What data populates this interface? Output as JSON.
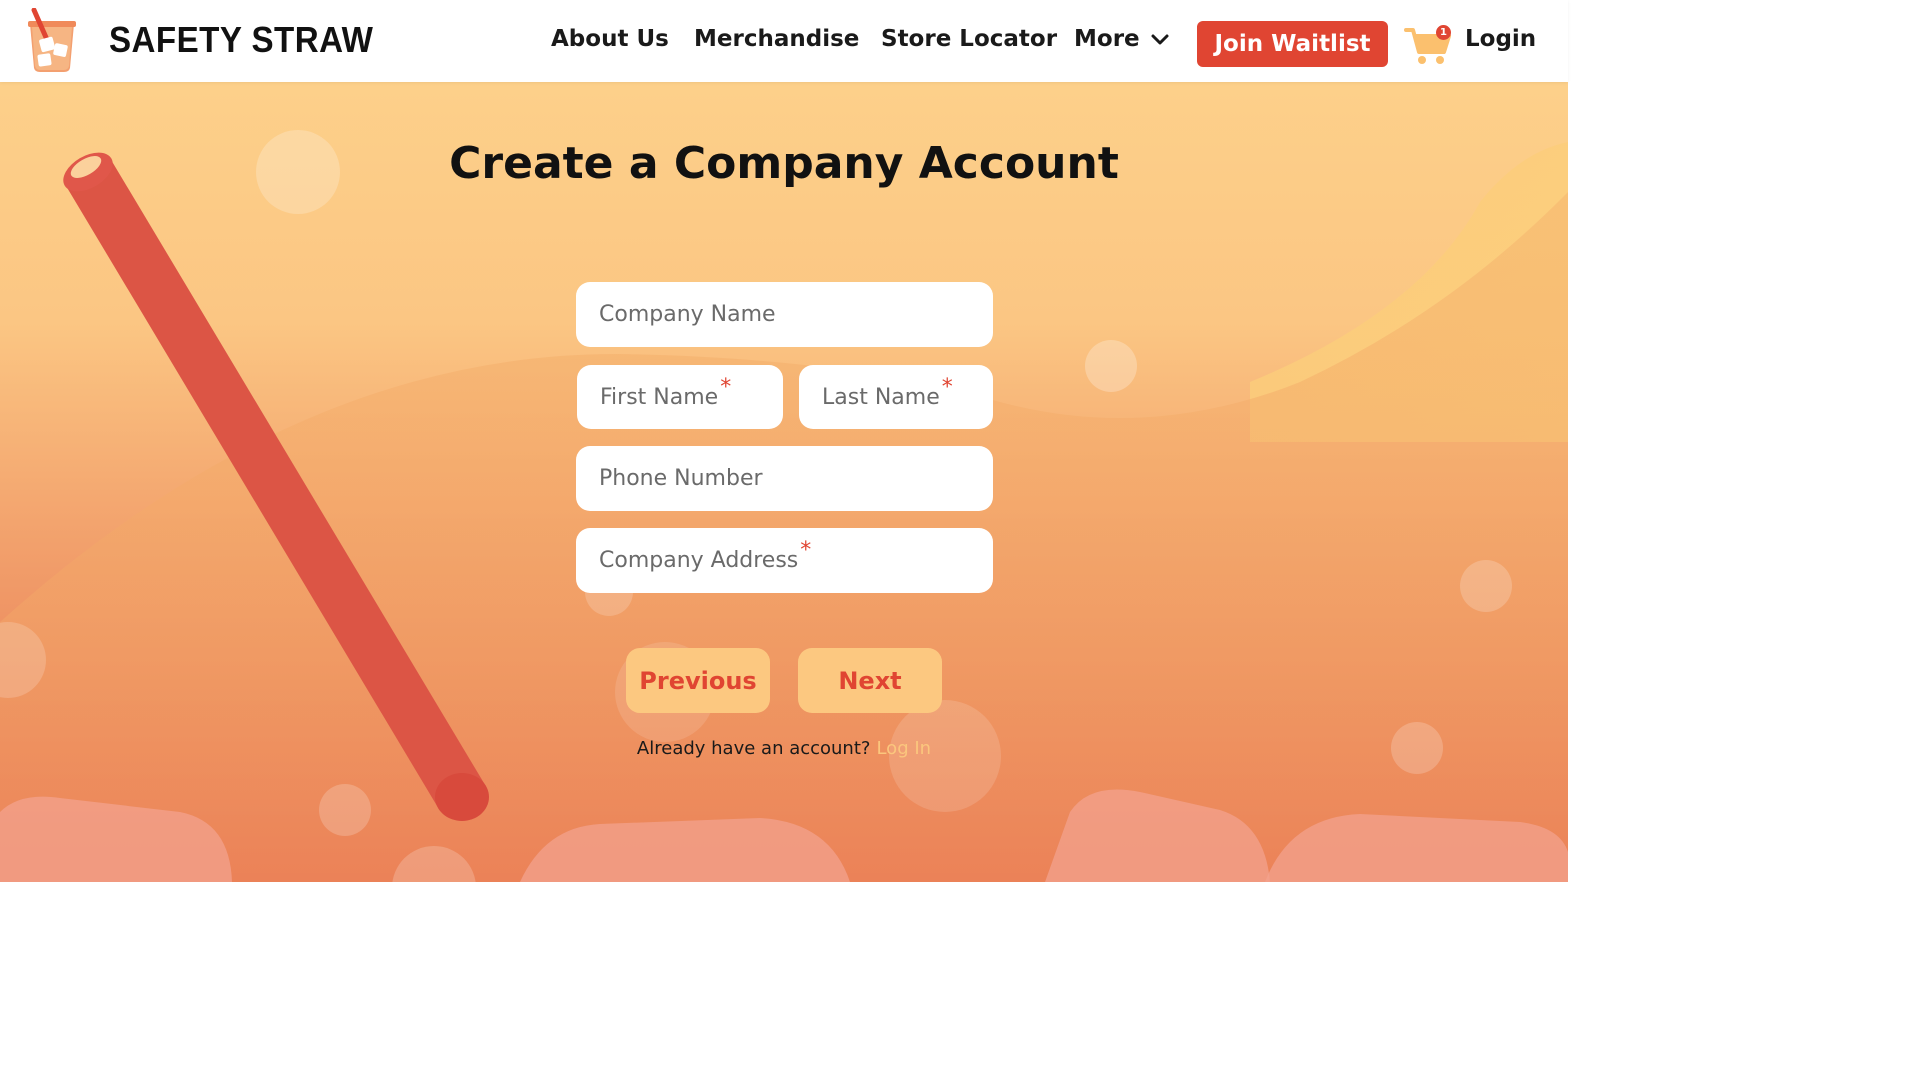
{
  "header": {
    "brand": "SAFETY STRAW",
    "logo_icon": "straw-cup-logo-icon",
    "nav": {
      "about": "About Us",
      "merchandise": "Merchandise",
      "store_locator": "Store Locator",
      "more": "More"
    },
    "join_waitlist": "Join Waitlist",
    "cart_count": "1",
    "login": "Login"
  },
  "main": {
    "title": "Create a Company Account",
    "fields": {
      "company_name": "Company Name",
      "first_name": "First Name",
      "last_name": "Last Name",
      "phone_number": "Phone Number",
      "company_address": "Company Address",
      "required_marker": "*"
    },
    "buttons": {
      "previous": "Previous",
      "next": "Next"
    },
    "login_prompt": {
      "question": "Already have an account?",
      "link": "Log In"
    }
  },
  "colors": {
    "accent": "#e04532",
    "button_bg": "#fcc880",
    "bg_top": "#fdd08a",
    "bg_bottom": "#e5644b",
    "link": "#fbc67d"
  }
}
